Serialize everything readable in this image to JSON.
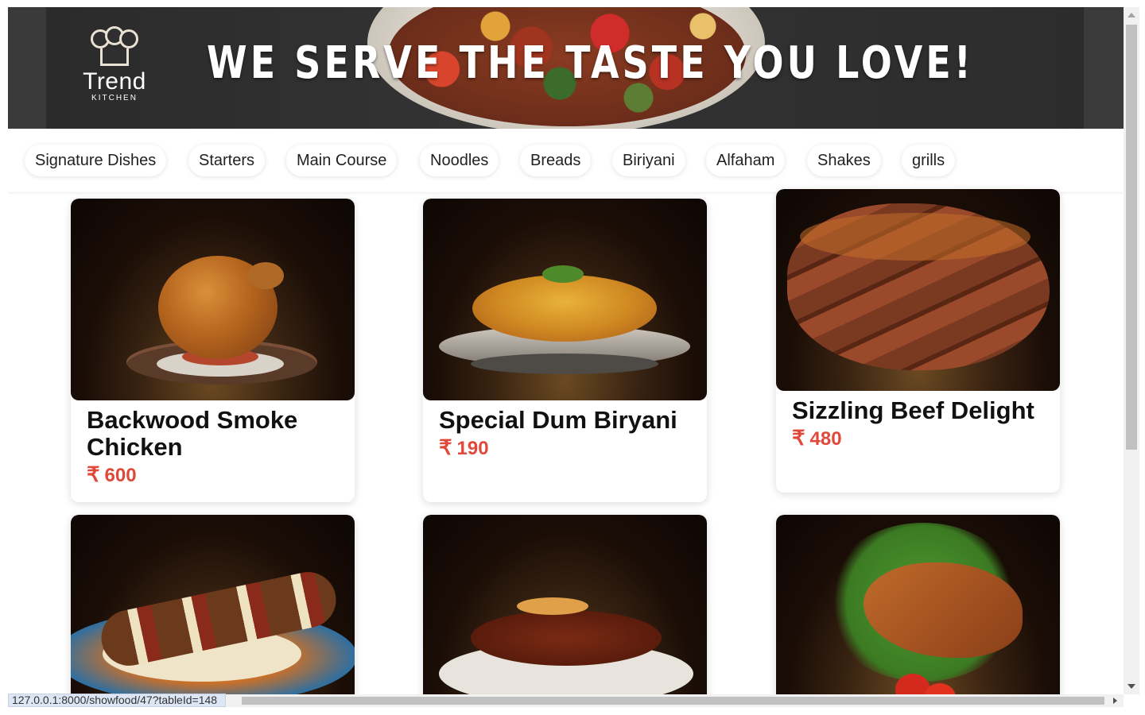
{
  "banner": {
    "logo_name": "Trend",
    "logo_sub": "KITCHEN",
    "slogan": "WE SERVE THE TASTE YOU LOVE!"
  },
  "categories": [
    {
      "label": "Signature Dishes"
    },
    {
      "label": "Starters"
    },
    {
      "label": "Main Course"
    },
    {
      "label": "Noodles"
    },
    {
      "label": "Breads"
    },
    {
      "label": "Biriyani"
    },
    {
      "label": "Alfaham"
    },
    {
      "label": "Shakes"
    },
    {
      "label": "grills"
    }
  ],
  "currency_symbol": "₹",
  "dishes": [
    {
      "name": "Backwood Smoke Chicken",
      "price": "600"
    },
    {
      "name": "Special Dum Biryani",
      "price": "190"
    },
    {
      "name": "Sizzling Beef Delight",
      "price": "480"
    }
  ],
  "status_bar": {
    "url": "127.0.0.1:8000/showfood/47?tableId=148"
  }
}
